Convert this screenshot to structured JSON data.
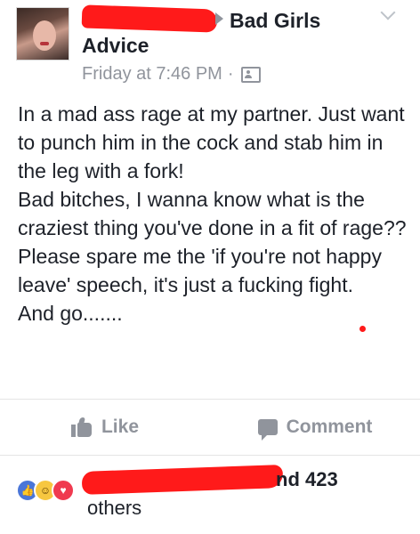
{
  "post": {
    "group_line_1": "Bad Girls",
    "group_line_2": "Advice",
    "timestamp": "Friday at 7:46 PM",
    "separator": "·",
    "privacy_icon": "members-icon",
    "body": [
      "In a mad ass rage at my partner. Just want to punch him in the cock and stab him in the leg with a fork!",
      "Bad bitches, I wanna know what is the craziest thing you've done in a fit of rage??",
      "Please spare me the 'if you're not happy leave' speech, it's just a fucking fight.",
      "And go......."
    ]
  },
  "actions": {
    "like_label": "Like",
    "comment_label": "Comment"
  },
  "reactions": {
    "icons": [
      "like-reaction-icon",
      "haha-reaction-icon",
      "love-reaction-icon"
    ],
    "summary_suffix": "nd 423",
    "summary_others": "others"
  },
  "colors": {
    "redaction": "#ff1a1a",
    "muted": "#90949c",
    "text": "#1d2129"
  }
}
